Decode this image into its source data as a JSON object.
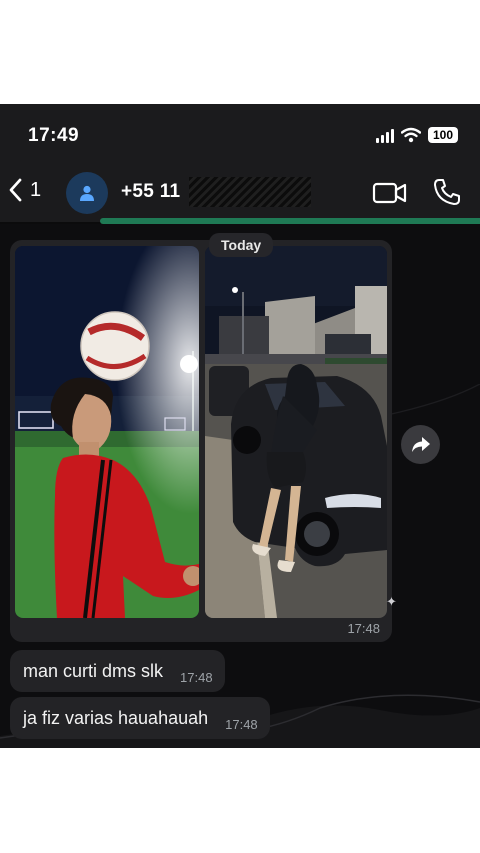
{
  "status_bar": {
    "time": "17:49",
    "battery": "100"
  },
  "header": {
    "back_count": "1",
    "contact": "+55 11",
    "icons": [
      "chevron-left-icon",
      "person-icon",
      "video-camera-icon",
      "phone-icon"
    ]
  },
  "chat": {
    "date_chip": "Today",
    "media": {
      "time": "17:48",
      "photo_count": 2
    },
    "messages": [
      {
        "text": "man curti dms slk",
        "time": "17:48"
      },
      {
        "text": "ja fiz varias hauahauah",
        "time": "17:48"
      }
    ]
  },
  "colors": {
    "header_bg": "#1b1b1d",
    "chat_bg": "#0d0d0f",
    "bubble_bg": "#232326",
    "accent_green": "#1f7a55",
    "avatar_bg": "#1c3a5c"
  }
}
